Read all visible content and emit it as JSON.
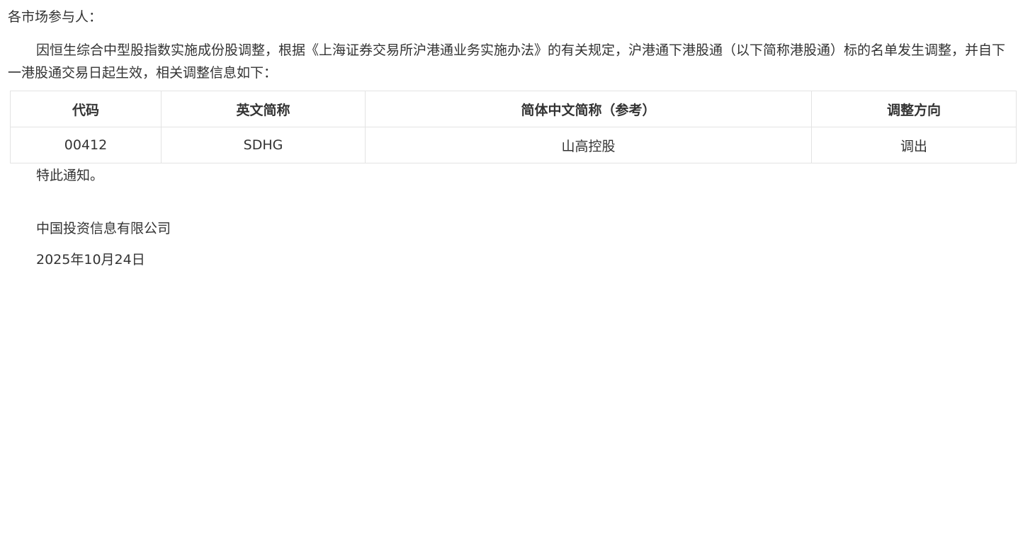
{
  "notice": {
    "greeting": "各市场参与人：",
    "body": "因恒生综合中型股指数实施成份股调整，根据《上海证券交易所沪港通业务实施办法》的有关规定，沪港通下港股通（以下简称港股通）标的名单发生调整，并自下一港股通交易日起生效，相关调整信息如下：",
    "table": {
      "headers": [
        "代码",
        "英文简称",
        "简体中文简称（参考）",
        "调整方向"
      ],
      "rows": [
        [
          "00412",
          "SDHG",
          "山高控股",
          "调出"
        ]
      ]
    },
    "closing": "特此通知。",
    "company": "中国投资信息有限公司",
    "date": "2025年10月24日"
  }
}
